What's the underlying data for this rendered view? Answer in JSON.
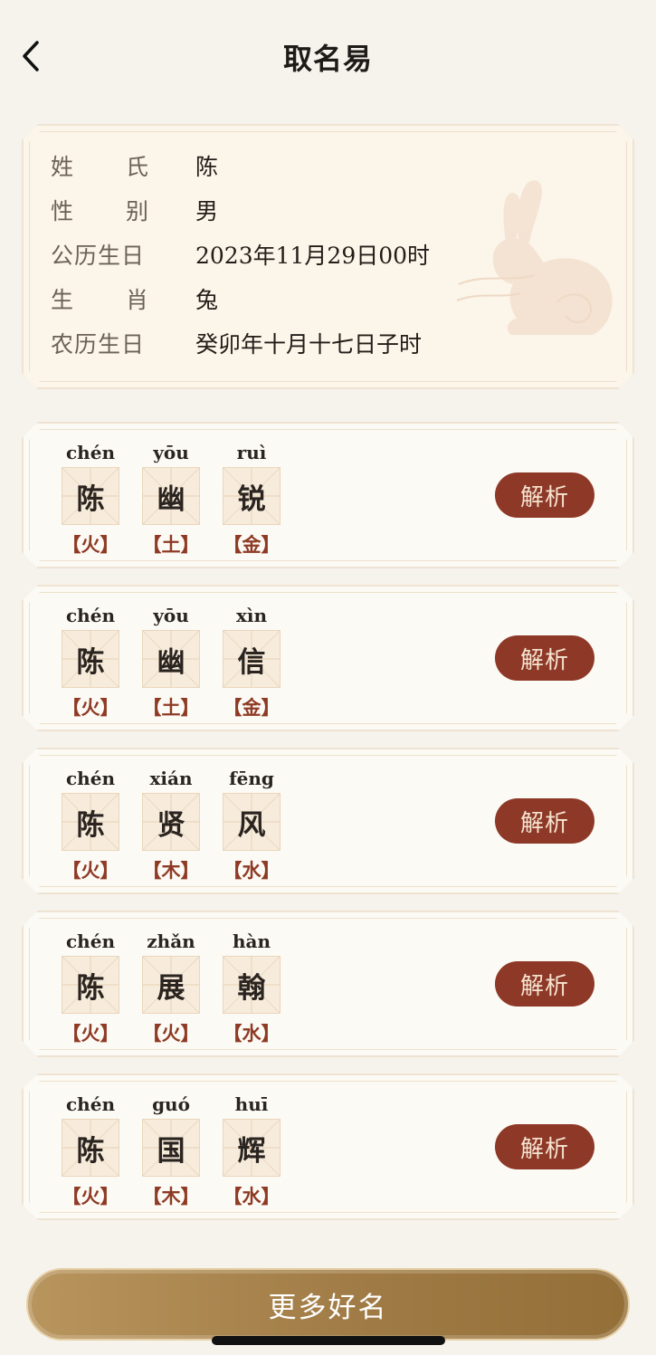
{
  "header": {
    "title": "取名易"
  },
  "info": {
    "rows": [
      {
        "label_a": "姓",
        "label_b": "氏",
        "value": "陈"
      },
      {
        "label_a": "性",
        "label_b": "别",
        "value": "男"
      },
      {
        "label": "公历生日",
        "value": "2023年11月29日00时"
      },
      {
        "label_a": "生",
        "label_b": "肖",
        "value": "兔"
      },
      {
        "label": "农历生日",
        "value": "癸卯年十月十七日子时"
      }
    ]
  },
  "names": [
    {
      "chars": [
        {
          "pinyin": "chén",
          "char": "陈",
          "element": "【火】"
        },
        {
          "pinyin": "yōu",
          "char": "幽",
          "element": "【土】"
        },
        {
          "pinyin": "ruì",
          "char": "锐",
          "element": "【金】"
        }
      ],
      "button": "解析"
    },
    {
      "chars": [
        {
          "pinyin": "chén",
          "char": "陈",
          "element": "【火】"
        },
        {
          "pinyin": "yōu",
          "char": "幽",
          "element": "【土】"
        },
        {
          "pinyin": "xìn",
          "char": "信",
          "element": "【金】"
        }
      ],
      "button": "解析"
    },
    {
      "chars": [
        {
          "pinyin": "chén",
          "char": "陈",
          "element": "【火】"
        },
        {
          "pinyin": "xián",
          "char": "贤",
          "element": "【木】"
        },
        {
          "pinyin": "fēng",
          "char": "风",
          "element": "【水】"
        }
      ],
      "button": "解析"
    },
    {
      "chars": [
        {
          "pinyin": "chén",
          "char": "陈",
          "element": "【火】"
        },
        {
          "pinyin": "zhǎn",
          "char": "展",
          "element": "【火】"
        },
        {
          "pinyin": "hàn",
          "char": "翰",
          "element": "【水】"
        }
      ],
      "button": "解析"
    },
    {
      "chars": [
        {
          "pinyin": "chén",
          "char": "陈",
          "element": "【火】"
        },
        {
          "pinyin": "guó",
          "char": "国",
          "element": "【木】"
        },
        {
          "pinyin": "huī",
          "char": "辉",
          "element": "【水】"
        }
      ],
      "button": "解析"
    }
  ],
  "footer": {
    "more_label": "更多好名"
  },
  "colors": {
    "accent": "#8e3828",
    "element_text": "#8e3a25",
    "gold": "#a07b45",
    "background": "#f6f2ec"
  },
  "icons": {
    "back": "chevron-left-icon",
    "zodiac": "rabbit-icon"
  }
}
